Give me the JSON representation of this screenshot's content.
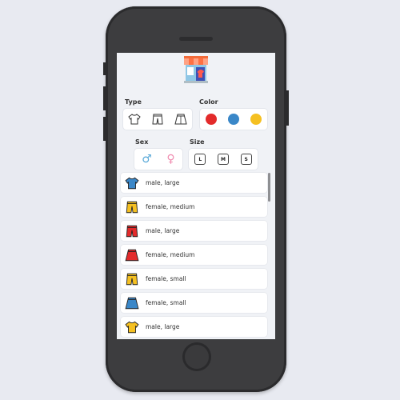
{
  "filters": {
    "type_label": "Type",
    "color_label": "Color",
    "sex_label": "Sex",
    "size_label": "Size",
    "type_icons": [
      "tshirt-icon",
      "shorts-icon",
      "skirt-icon"
    ],
    "colors": [
      "#e32b2b",
      "#3a87c8",
      "#f5c021"
    ],
    "sex_symbols": {
      "male": "♂",
      "female": "♀"
    },
    "sizes": [
      "L",
      "M",
      "S"
    ]
  },
  "items": [
    {
      "icon": "tshirt-icon",
      "color": "#3a87c8",
      "label": "male, large"
    },
    {
      "icon": "shorts-icon",
      "color": "#f5c021",
      "label": "female, medium"
    },
    {
      "icon": "shorts-icon",
      "color": "#e32b2b",
      "label": "male, large"
    },
    {
      "icon": "skirt-icon",
      "color": "#e32b2b",
      "label": "female, medium"
    },
    {
      "icon": "shorts-icon",
      "color": "#f5c021",
      "label": "female, small"
    },
    {
      "icon": "skirt-icon",
      "color": "#3a87c8",
      "label": "female, small"
    },
    {
      "icon": "tshirt-icon",
      "color": "#f5c021",
      "label": "male, large"
    }
  ]
}
